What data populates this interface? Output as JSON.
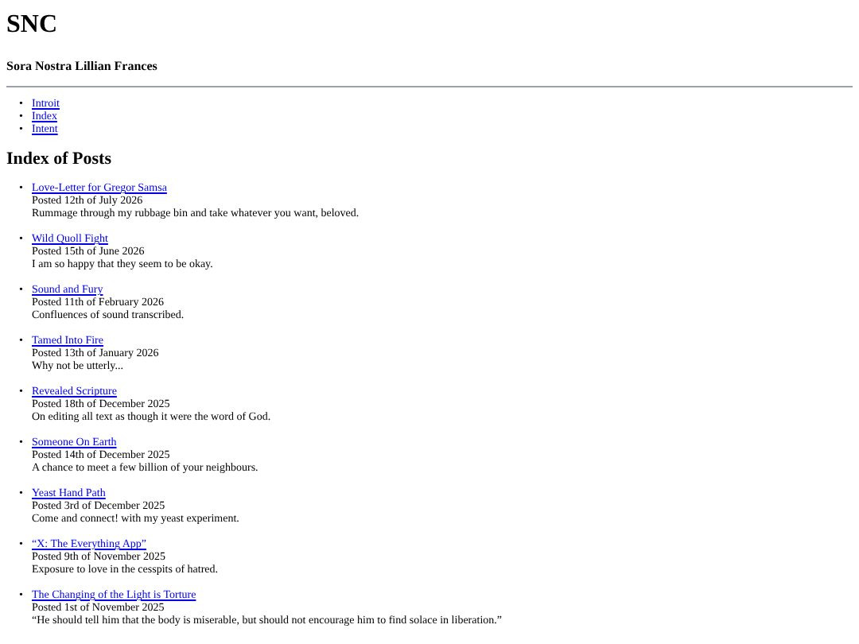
{
  "site_title": "SNC",
  "subtitle": "Sora Nostra Lillian Frances",
  "nav": [
    {
      "marker": "•",
      "label": "Introit"
    },
    {
      "marker": "•",
      "label": "Index"
    },
    {
      "marker": "•",
      "label": "Intent"
    }
  ],
  "section_heading": "Index of Posts",
  "posts": [
    {
      "marker": "•",
      "title": "Love-Letter for Gregor Samsa",
      "date": "Posted 12th of July 2026",
      "summary": "Rummage through my rubbage bin and take whatever you want, beloved."
    },
    {
      "marker": "•",
      "title": "Wild Quoll Fight",
      "date": "Posted 15th of June 2026",
      "summary": "I am so happy that they seem to be okay."
    },
    {
      "marker": "•",
      "title": "Sound and Fury",
      "date": "Posted 11th of February 2026",
      "summary": "Confluences of sound transcribed."
    },
    {
      "marker": "•",
      "title": "Tamed Into Fire",
      "date": "Posted 13th of January 2026",
      "summary": "Why not be utterly..."
    },
    {
      "marker": "•",
      "title": "Revealed Scripture",
      "date": "Posted 18th of December 2025",
      "summary": "On editing all text as though it were the word of God."
    },
    {
      "marker": "•",
      "title": "Someone On Earth",
      "date": "Posted 14th of December 2025",
      "summary": "A chance to meet a few billion of your neighbours."
    },
    {
      "marker": "•",
      "title": "Yeast Hand Path",
      "date": "Posted 3rd of December 2025",
      "summary": "Come and connect! with my yeast experiment."
    },
    {
      "marker": "•",
      "title": "“X: The Everything App”",
      "date": "Posted 9th of November 2025",
      "summary": "Exposure to love in the cesspits of hatred."
    },
    {
      "marker": "•",
      "title": "The Changing of the Light is Torture",
      "date": "Posted 1st of November 2025",
      "summary": "“He should tell him that the body is miserable, but should not encourage him to find solace in liberation.”"
    }
  ]
}
